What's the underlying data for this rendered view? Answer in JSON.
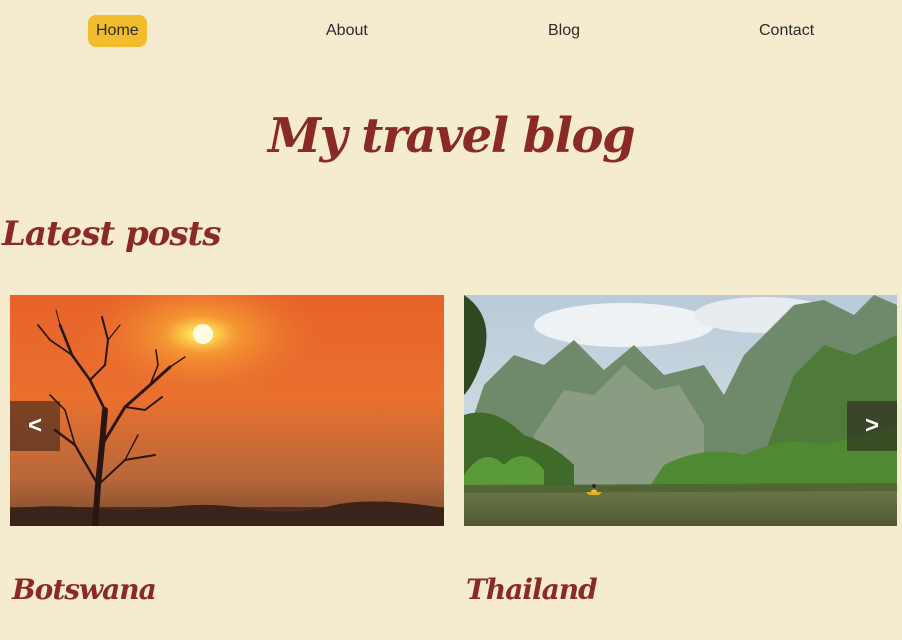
{
  "nav": {
    "items": [
      {
        "label": "Home",
        "active": true
      },
      {
        "label": "About",
        "active": false
      },
      {
        "label": "Blog",
        "active": false
      },
      {
        "label": "Contact",
        "active": false
      }
    ]
  },
  "header": {
    "title": "My travel blog"
  },
  "latest": {
    "heading": "Latest posts",
    "posts": [
      {
        "title": "Botswana"
      },
      {
        "title": "Thailand"
      }
    ],
    "prev_label": "<",
    "next_label": ">"
  },
  "colors": {
    "background": "#f5ebcf",
    "accent": "#f2bd2c",
    "heading": "#8a2a26"
  }
}
